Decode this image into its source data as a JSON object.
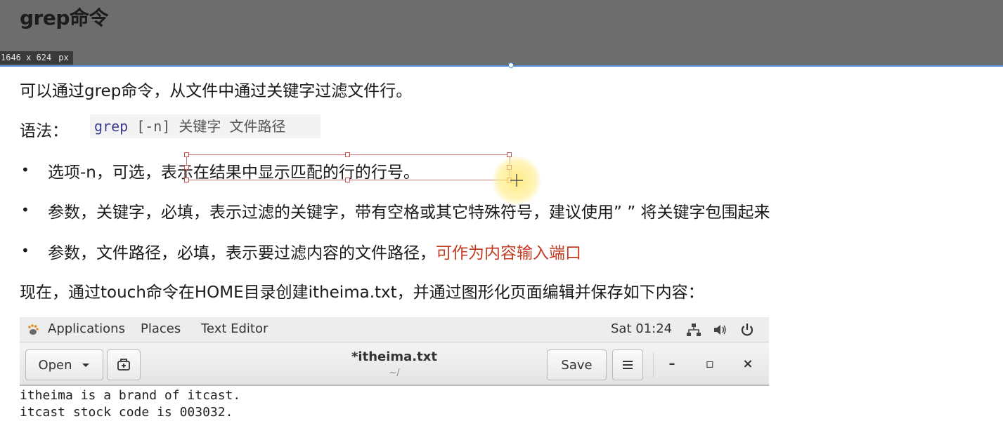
{
  "slide": {
    "title": "grep命令",
    "dimension_label": "1646 x 624",
    "dimension_unit": "px",
    "intro": "可以通过grep命令，从文件中通过关键字过滤文件行。",
    "syntax_label": "语法：",
    "syntax_code_keyword": "grep",
    "syntax_code_rest": " [-n] 关键字 文件路径",
    "bullets": [
      {
        "marker": "•",
        "lead": "选项-n，可选，",
        "text": "表示在结果中显示匹配的行的行号。"
      },
      {
        "marker": "•",
        "text": "参数，关键字，必填，表示过滤的关键字，带有空格或其它特殊符号，建议使用” ” 将关键字包围起来"
      },
      {
        "marker": "•",
        "text": "参数，文件路径，必填，表示要过滤内容的文件路径，",
        "highlight": "可作为内容输入端口",
        "highlight_color": "#c23b22"
      }
    ],
    "now_line": "现在，通过touch命令在HOME目录创建itheima.txt，并通过图形化页面编辑并保存如下内容："
  },
  "gnome_topbar": {
    "applications": "Applications",
    "places": "Places",
    "text_editor": "Text Editor",
    "clock": "Sat 01:24"
  },
  "gedit": {
    "open_label": "Open",
    "doc_title": "*itheima.txt",
    "doc_path": "~/",
    "save_label": "Save",
    "minimize": "–",
    "maximize": "▫",
    "close": "×"
  },
  "editor_content": {
    "lines": [
      "itheima is a brand of itcast.",
      "itcast stock code is 003032."
    ]
  },
  "icons": {
    "menu": "hamburger-icon",
    "new_doc": "new-document-icon",
    "network": "network-icon",
    "volume": "volume-icon",
    "power": "power-icon",
    "gnome": "gnome-foot-icon"
  }
}
